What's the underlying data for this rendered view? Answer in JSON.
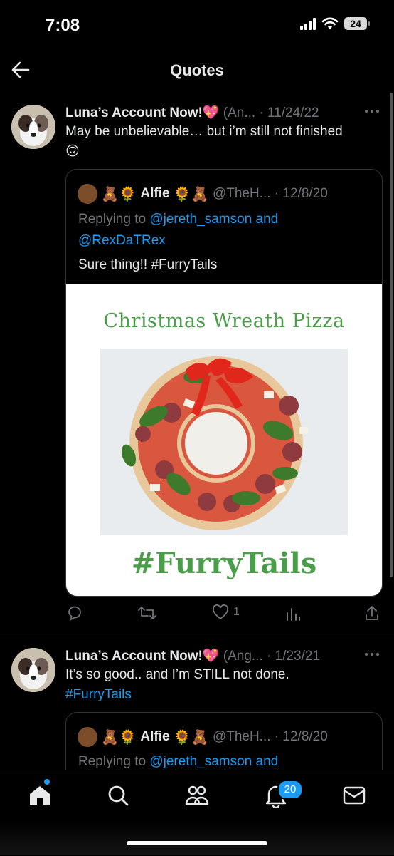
{
  "status": {
    "time": "7:08",
    "battery": "24"
  },
  "header": {
    "title": "Quotes"
  },
  "tweets": [
    {
      "name": "Luna’s Account Now!💖",
      "handle": "(An...",
      "dot": "·",
      "date": "11/24/22",
      "text": "May be unbelievable… but i’m still not finished🙃",
      "quote": {
        "emojis_before": "🧸🌻",
        "name": "Alfie",
        "emojis_after": "🌻🧸",
        "handle": "@TheH...",
        "dot": "·",
        "date": "12/8/20",
        "replying_prefix": "Replying to",
        "reply_user_1": "@jereth_samson",
        "reply_and": "and",
        "reply_user_2": "@RexDaTRex",
        "text": "Sure thing!! #FurryTails",
        "image_title": "Christmas Wreath Pizza",
        "image_hashtag": "#FurryTails"
      },
      "like_count": "1"
    },
    {
      "name": "Luna’s Account Now!💖",
      "handle": "(Ang...",
      "dot": "·",
      "date": "1/23/21",
      "text": "It’s so good.. and I’m STILL not done.",
      "hashtag": "#FurryTails",
      "quote": {
        "emojis_before": "🧸🌻",
        "name": "Alfie",
        "emojis_after": "🌻🧸",
        "handle": "@TheH...",
        "dot": "·",
        "date": "12/8/20",
        "replying_prefix": "Replying to",
        "reply_user_1": "@jereth_samson",
        "reply_and": "and"
      }
    }
  ],
  "tabbar": {
    "notifications_badge": "20"
  },
  "colors": {
    "accent": "#1d9bf0",
    "background": "#000000",
    "muted": "#71767b",
    "pizza_green": "#4a9e4a"
  },
  "icons": [
    "back-arrow-icon",
    "more-icon",
    "reply-icon",
    "retweet-icon",
    "like-icon",
    "views-icon",
    "share-icon",
    "home-icon",
    "search-icon",
    "communities-icon",
    "notifications-icon",
    "messages-icon"
  ]
}
